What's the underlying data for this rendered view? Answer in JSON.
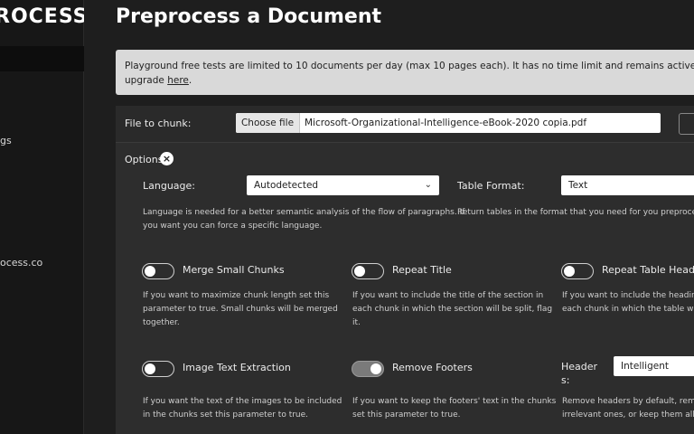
{
  "sidebar": {
    "logo": "ROCESS",
    "items": [
      {
        "label": "gs"
      },
      {
        "label": "ocess.co"
      }
    ]
  },
  "header": {
    "title": "Preprocess a Document"
  },
  "notice": {
    "line1": "Playground free tests are limited to 10 documents per day (max 10 pages each). It has no time limit and remains active until you choo",
    "line2_prefix": "upgrade ",
    "link": "here",
    "line2_suffix": "."
  },
  "file": {
    "label": "File to chunk:",
    "button": "Choose file",
    "filename": "Microsoft-Organizational-Intelligence-eBook-2020 copia.pdf"
  },
  "options": {
    "label": "Options",
    "close_glyph": "×",
    "language": {
      "label": "Language:",
      "value": "Autodetected",
      "help1": "Language is needed for a better semantic analysis of the flow of paragraphs. If",
      "help2": "you want you can force a specific language."
    },
    "table_format": {
      "label": "Table Format:",
      "value": "Text",
      "help1": "Return tables in the format that you need for you preprocessin"
    },
    "merge_small_chunks": {
      "label": "Merge Small Chunks",
      "on": false,
      "help1": "If you want to maximize chunk length set this",
      "help2": "parameter to true. Small chunks will be merged",
      "help3": "together."
    },
    "repeat_title": {
      "label": "Repeat Title",
      "on": false,
      "help1": "If you want to include the title of the section in",
      "help2": "each chunk in which the section will be split, flag",
      "help3": "it."
    },
    "repeat_table_header": {
      "label": "Repeat Table Header",
      "on": false,
      "help1": "If you want to include the heading o",
      "help2": "each chunk in which the table will b"
    },
    "image_text_extraction": {
      "label": "Image Text Extraction",
      "on": false,
      "help1": "If you want the text of the images to be included",
      "help2": "in the chunks set this parameter to true."
    },
    "remove_footers": {
      "label": "Remove Footers",
      "on": true,
      "help1": "If you want to keep the footers' text in the chunks",
      "help2": "set this parameter to true."
    },
    "headers": {
      "label_line1": "Header",
      "label_line2": "s:",
      "value": "Intelligent",
      "help1": "Remove headers by default, remove",
      "help2": "irrelevant ones, or keep them all."
    }
  }
}
